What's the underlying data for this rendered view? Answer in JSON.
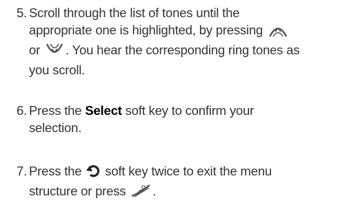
{
  "colors": {
    "text": "#333333",
    "bold": "#000000"
  },
  "steps": [
    {
      "number": "5.",
      "line1": "Scroll through the list of tones until the",
      "line2_a": "appropriate one is highlighted, by pressing",
      "line3_a": "or",
      "line3_b": ". You hear the corresponding ring tones as",
      "line4": "you scroll."
    },
    {
      "number": "6.",
      "text_a": "Press the",
      "bold": "Select",
      "text_b": "soft key to confirm your",
      "line2": "selection."
    },
    {
      "number": "7.",
      "text_a": "Press the",
      "text_b": "soft key twice to exit the menu",
      "line2": "structure or press",
      "line2_end": "."
    }
  ],
  "icons": [
    "scroll-up-key-icon",
    "scroll-down-key-icon",
    "back-arrow-icon",
    "end-call-key-icon"
  ]
}
